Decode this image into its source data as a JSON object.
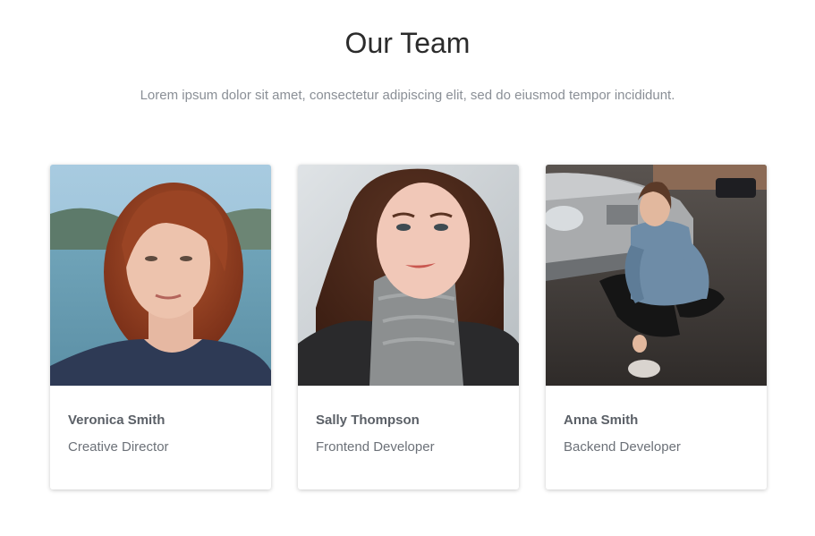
{
  "section": {
    "title": "Our Team",
    "subtitle": "Lorem ipsum dolor sit amet, consectetur adipiscing elit, sed do eiusmod tempor incididunt."
  },
  "team": [
    {
      "name": "Veronica Smith",
      "role": "Creative Director",
      "photo": "portrait-red-hair-lake"
    },
    {
      "name": "Sally Thompson",
      "role": "Frontend Developer",
      "photo": "portrait-gray-scarf-snow"
    },
    {
      "name": "Anna Smith",
      "role": "Backend Developer",
      "photo": "portrait-sitting-street-car"
    }
  ],
  "colors": {
    "title": "#2b2b2b",
    "subtitle": "#8a8f96",
    "name": "#5b6067",
    "role": "#6c7178"
  }
}
